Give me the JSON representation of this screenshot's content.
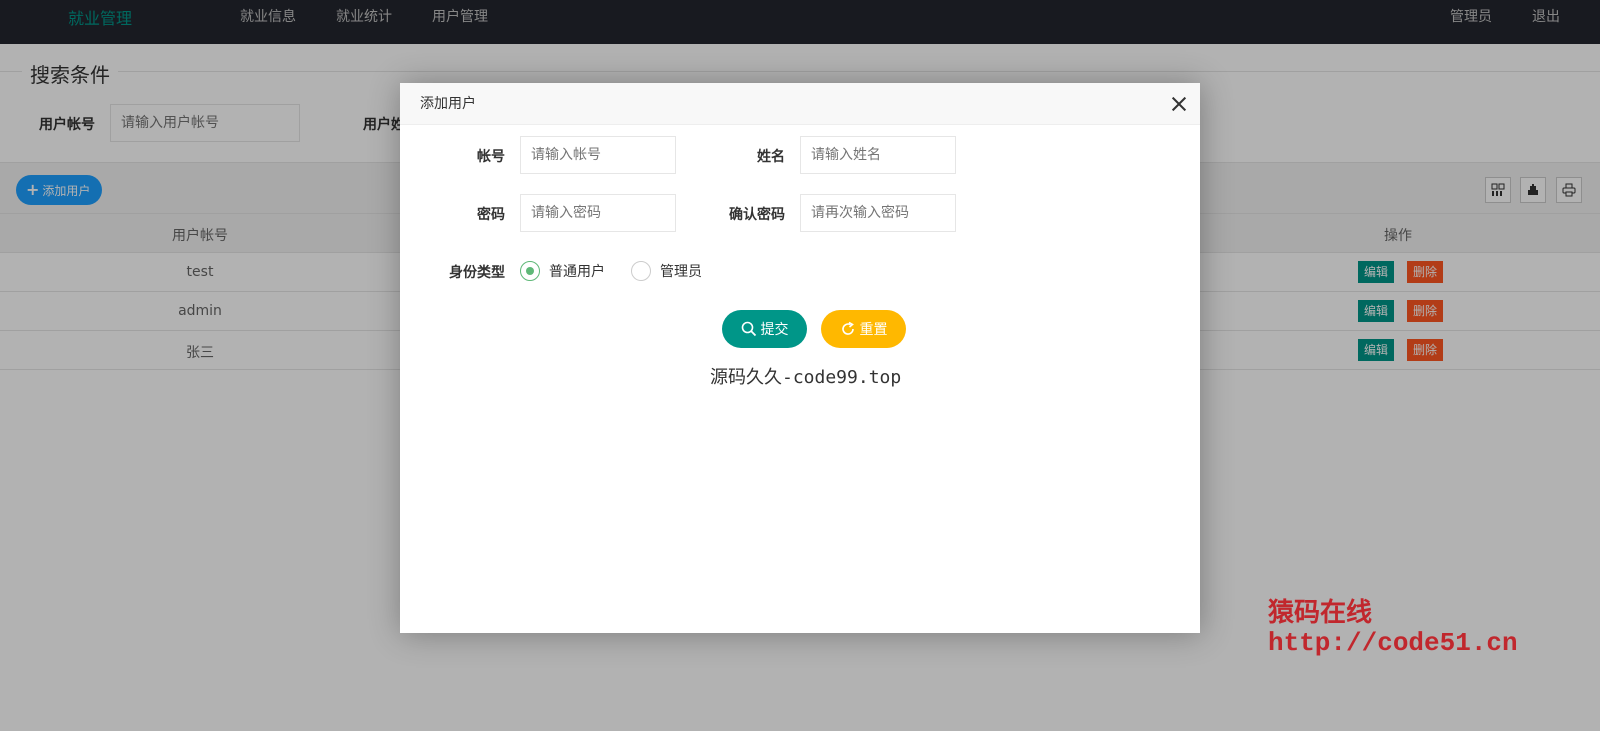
{
  "header": {
    "logo": "就业管理",
    "nav": [
      "就业信息",
      "就业统计",
      "用户管理"
    ],
    "user": "管理员",
    "logout": "退出"
  },
  "search": {
    "legend": "搜索条件",
    "account_label": "用户帐号",
    "account_placeholder": "请输入用户帐号",
    "name_label": "用户姓"
  },
  "toolbar": {
    "add_label": "添加用户",
    "icons": [
      "columns-icon",
      "export-icon",
      "print-icon"
    ]
  },
  "table": {
    "col_account": "用户帐号",
    "col_actions": "操作",
    "rows": [
      {
        "account": "test"
      },
      {
        "account": "admin"
      },
      {
        "account": "张三"
      }
    ],
    "edit_label": "编辑",
    "delete_label": "删除"
  },
  "modal": {
    "title": "添加用户",
    "account_label": "帐号",
    "account_placeholder": "请输入帐号",
    "name_label": "姓名",
    "name_placeholder": "请输入姓名",
    "password_label": "密码",
    "password_placeholder": "请输入密码",
    "confirm_label": "确认密码",
    "confirm_placeholder": "请再次输入密码",
    "role_label": "身份类型",
    "role_options": [
      "普通用户",
      "管理员"
    ],
    "role_selected": "普通用户",
    "submit_label": "提交",
    "reset_label": "重置",
    "caption": "源码久久-code99.top"
  },
  "watermark": {
    "line1": "猿码在线",
    "line2": "http://code51.cn"
  },
  "colors": {
    "header_bg": "#23262e",
    "accent": "#009688",
    "blue": "#1e9fff",
    "danger": "#ff5722",
    "warm": "#ffb800",
    "watermark": "#c1272d"
  }
}
